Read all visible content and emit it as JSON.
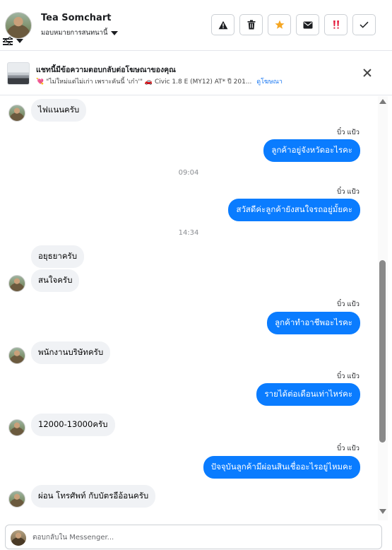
{
  "header": {
    "contact_name": "Tea Somchart",
    "assign_label": "มอบหมายการสนทนานี้",
    "actions": [
      {
        "name": "report-spam-button",
        "icon": "warning-icon"
      },
      {
        "name": "delete-button",
        "icon": "trash-icon"
      },
      {
        "name": "star-button",
        "icon": "star-icon"
      },
      {
        "name": "mark-unread-button",
        "icon": "envelope-icon"
      },
      {
        "name": "mark-important-button",
        "icon": "exclamation-icon"
      },
      {
        "name": "mark-done-button",
        "icon": "check-icon"
      }
    ],
    "star_color": "#f5a623",
    "important_color": "#e41e3f"
  },
  "ad": {
    "title": "แชทนี้มีข้อความตอบกลับต่อโฆษณาของคุณ",
    "description": "💘 \"ไม่ใหม่แต่ไม่เก่า เพราะคันนี้ 'เก๋า'\" 🚗 Civic 1.8 E (MY12) AT* ปี 201...",
    "link": "ดูโฆษณา"
  },
  "conversation": {
    "messages": [
      {
        "type": "in",
        "text": "ไฟแนนครับ",
        "avatar": true
      },
      {
        "type": "sender",
        "text": "บิ๋ว แป้ว"
      },
      {
        "type": "out",
        "text": "ลูกค้าอยู่จังหวัดอะไรคะ"
      },
      {
        "type": "time",
        "text": "09:04"
      },
      {
        "type": "sender",
        "text": "บิ๋ว แป้ว"
      },
      {
        "type": "out",
        "text": "สวัสดีค่ะลูกค้ายังสนใจรถอยู่มั้ยคะ"
      },
      {
        "type": "time",
        "text": "14:34"
      },
      {
        "type": "in",
        "text": "อยุธยาครับ",
        "avatar": false
      },
      {
        "type": "in",
        "text": "สนใจครับ",
        "avatar": true
      },
      {
        "type": "sender",
        "text": "บิ๋ว แป้ว"
      },
      {
        "type": "out",
        "text": "ลูกค้าทำอาชีพอะไรคะ"
      },
      {
        "type": "in",
        "text": "พนักงานบริษัทครับ",
        "avatar": true
      },
      {
        "type": "sender",
        "text": "บิ๋ว แป้ว"
      },
      {
        "type": "out",
        "text": "รายได้ต่อเดือนเท่าไหร่คะ"
      },
      {
        "type": "in",
        "text": "12000-13000ครับ",
        "avatar": true
      },
      {
        "type": "sender",
        "text": "บิ๋ว แป้ว"
      },
      {
        "type": "out",
        "text": "ปัจจุบันลูกค้ามีผ่อนสินเชื่ออะไรอยู่ไหมคะ"
      },
      {
        "type": "in",
        "text": "ผ่อน โทรศัพท์ กับบัตรอีอ้อนครับ",
        "avatar": true
      }
    ]
  },
  "composer": {
    "placeholder": "ตอบกลับใน Messenger..."
  },
  "colors": {
    "outgoing_bubble": "#0a7cff",
    "incoming_bubble": "#f0f2f5",
    "link": "#1877f2"
  }
}
